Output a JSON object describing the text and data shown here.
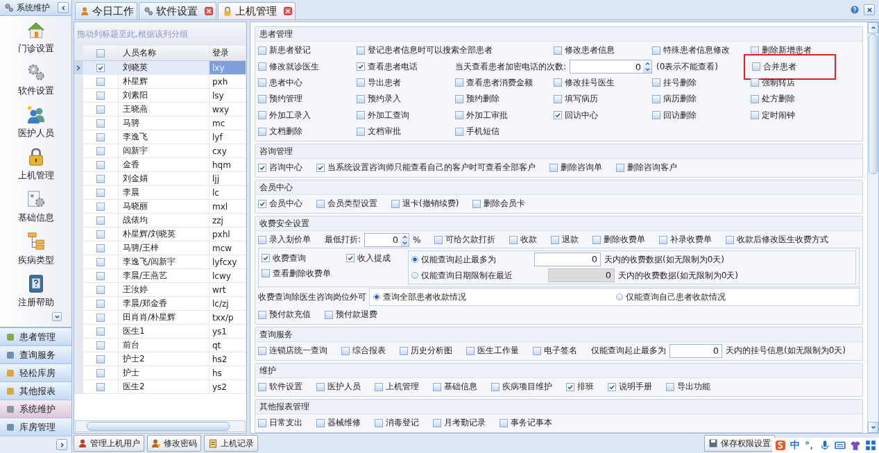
{
  "sidebar": {
    "title": "系统维护",
    "items": [
      {
        "label": "门诊设置"
      },
      {
        "label": "软件设置"
      },
      {
        "label": "医护人员"
      },
      {
        "label": "上机管理"
      },
      {
        "label": "基础信息"
      },
      {
        "label": "疾病类型"
      },
      {
        "label": "注册帮助"
      }
    ],
    "nav": [
      {
        "label": "患者管理",
        "selected": false
      },
      {
        "label": "查询服务",
        "selected": false
      },
      {
        "label": "轻松库房",
        "selected": false
      },
      {
        "label": "其他报表",
        "selected": false
      },
      {
        "label": "系统维护",
        "selected": true
      },
      {
        "label": "库房管理",
        "selected": false
      }
    ]
  },
  "tabs": [
    {
      "label": "今日工作",
      "selected": false,
      "closable": false
    },
    {
      "label": "软件设置",
      "selected": false,
      "closable": true
    },
    {
      "label": "上机管理",
      "selected": true,
      "closable": true
    }
  ],
  "users": {
    "group_hint": "拖动列标题至此,根据该列分组",
    "all_checked": false,
    "columns": [
      "人员名称",
      "登录"
    ],
    "rows": [
      {
        "name": "刘晓英",
        "login": "lxy",
        "checked": true,
        "selected": true
      },
      {
        "name": "朴星辉",
        "login": "pxh",
        "checked": false,
        "selected": false
      },
      {
        "name": "刘素阳",
        "login": "lsy",
        "checked": false,
        "selected": false
      },
      {
        "name": "王晓燕",
        "login": "wxy",
        "checked": false,
        "selected": false
      },
      {
        "name": "马骋",
        "login": "mc",
        "checked": false,
        "selected": false
      },
      {
        "name": "李逸飞",
        "login": "lyf",
        "checked": false,
        "selected": false
      },
      {
        "name": "闾新宇",
        "login": "cxy",
        "checked": false,
        "selected": false
      },
      {
        "name": "金香",
        "login": "hqm",
        "checked": false,
        "selected": false
      },
      {
        "name": "刘金娟",
        "login": "ljj",
        "checked": false,
        "selected": false
      },
      {
        "name": "李晨",
        "login": "lc",
        "checked": false,
        "selected": false
      },
      {
        "name": "马晓丽",
        "login": "mxl",
        "checked": false,
        "selected": false
      },
      {
        "name": "战俵均",
        "login": "zzj",
        "checked": false,
        "selected": false
      },
      {
        "name": "朴星辉/刘晓英",
        "login": "pxhl",
        "checked": false,
        "selected": false
      },
      {
        "name": "马骋/王梓",
        "login": "mcw",
        "checked": false,
        "selected": false
      },
      {
        "name": "李逸飞/闾新宇",
        "login": "lyfcxy",
        "checked": false,
        "selected": false
      },
      {
        "name": "李晨/王燕艺",
        "login": "lcwy",
        "checked": false,
        "selected": false
      },
      {
        "name": "王汝婷",
        "login": "wrt",
        "checked": false,
        "selected": false
      },
      {
        "name": "李晨/郑金香",
        "login": "lc/zj",
        "checked": false,
        "selected": false
      },
      {
        "name": "田肖肖/朴星辉",
        "login": "txx/p",
        "checked": false,
        "selected": false
      },
      {
        "name": "医生1",
        "login": "ys1",
        "checked": false,
        "selected": false
      },
      {
        "name": "前台",
        "login": "qt",
        "checked": false,
        "selected": false
      },
      {
        "name": "护士2",
        "login": "hs2",
        "checked": false,
        "selected": false
      },
      {
        "name": "护士",
        "login": "hs",
        "checked": false,
        "selected": false
      },
      {
        "name": "医生2",
        "login": "ys2",
        "checked": false,
        "selected": false
      }
    ],
    "buttons": [
      "管理上机用户",
      "修改密码",
      "上机记录"
    ]
  },
  "sections": [
    {
      "title": "患者管理",
      "kind": "grid",
      "rows": [
        [
          {
            "kind": "checkbox",
            "label": "新患者登记",
            "checked": false
          },
          {
            "kind": "checkbox",
            "label": "登记患者信息时可以搜索全部患者",
            "checked": false
          },
          {
            "kind": "checkbox",
            "label": "修改患者信息",
            "checked": false
          },
          {
            "kind": "checkbox",
            "label": "特殊患者信息修改",
            "checked": false
          },
          {
            "kind": "checkbox",
            "label": "删除新增患者",
            "checked": false
          }
        ],
        [
          {
            "kind": "checkbox",
            "label": "修改就诊医生",
            "checked": false
          },
          {
            "kind": "checkbox",
            "label": "查看患者电话",
            "checked": true
          },
          {
            "kind": "spin",
            "label": "当天查看患者加密电话的次数:",
            "value": "0"
          },
          {
            "kind": "note",
            "label": "(0表示不能查看)"
          },
          {
            "kind": "checkbox",
            "label": "合并患者",
            "checked": false,
            "highlighted": true
          }
        ],
        [
          {
            "kind": "checkbox",
            "label": "患者中心",
            "checked": false
          },
          {
            "kind": "checkbox",
            "label": "导出患者",
            "checked": false
          },
          {
            "kind": "checkbox",
            "label": "查看患者消费金额",
            "checked": false
          },
          {
            "kind": "checkbox",
            "label": "修改挂号医生",
            "checked": false
          },
          {
            "kind": "checkbox",
            "label": "挂号删除",
            "checked": false
          },
          {
            "kind": "checkbox",
            "label": "强制转店",
            "checked": false
          }
        ],
        [
          {
            "kind": "checkbox",
            "label": "预约管理",
            "checked": false
          },
          {
            "kind": "checkbox",
            "label": "预约录入",
            "checked": false
          },
          {
            "kind": "checkbox",
            "label": "预约删除",
            "checked": false
          },
          {
            "kind": "checkbox",
            "label": "填写病历",
            "checked": false
          },
          {
            "kind": "checkbox",
            "label": "病历删除",
            "checked": false
          },
          {
            "kind": "checkbox",
            "label": "处方删除",
            "checked": false
          }
        ],
        [
          {
            "kind": "checkbox",
            "label": "外加工录入",
            "checked": false
          },
          {
            "kind": "checkbox",
            "label": "外加工查询",
            "checked": false
          },
          {
            "kind": "checkbox",
            "label": "外加工审批",
            "checked": false
          },
          {
            "kind": "checkbox",
            "label": "回访中心",
            "checked": true
          },
          {
            "kind": "checkbox",
            "label": "回访删除",
            "checked": false
          },
          {
            "kind": "checkbox",
            "label": "定时闹钟",
            "checked": false
          }
        ],
        [
          {
            "kind": "checkbox",
            "label": "文档删除",
            "checked": false
          },
          {
            "kind": "checkbox",
            "label": "文档审批",
            "checked": false
          },
          {
            "kind": "checkbox",
            "label": "手机短信",
            "checked": false
          }
        ]
      ]
    },
    {
      "title": "咨询管理",
      "kind": "flow",
      "rows": [
        [
          {
            "kind": "checkbox",
            "label": "咨询中心",
            "checked": true
          },
          {
            "kind": "checkbox",
            "label": "当系统设置咨询师只能查看自己的客户时可查看全部客户",
            "checked": true
          },
          {
            "kind": "checkbox",
            "label": "删除咨询单",
            "checked": false
          },
          {
            "kind": "checkbox",
            "label": "删除咨询客户",
            "checked": false
          }
        ]
      ]
    },
    {
      "title": "会员中心",
      "kind": "flow",
      "rows": [
        [
          {
            "kind": "checkbox",
            "label": "会员中心",
            "checked": true
          },
          {
            "kind": "checkbox",
            "label": "会员类型设置",
            "checked": false
          },
          {
            "kind": "checkbox",
            "label": "退卡(撤销续费)",
            "checked": false
          },
          {
            "kind": "checkbox",
            "label": "删除会员卡",
            "checked": false
          }
        ]
      ]
    },
    {
      "title": "收费安全设置",
      "kind": "flow",
      "rows": [
        [
          {
            "kind": "checkbox",
            "label": "录入划价单",
            "checked": false
          },
          {
            "kind": "spin",
            "label": "最低打折:",
            "value": "0",
            "unit": "%"
          },
          {
            "kind": "checkbox",
            "label": "可给欠款打折",
            "checked": false
          },
          {
            "kind": "checkbox",
            "label": "收款",
            "checked": false
          },
          {
            "kind": "checkbox",
            "label": "退款",
            "checked": false
          },
          {
            "kind": "checkbox",
            "label": "删除收费单",
            "checked": false
          },
          {
            "kind": "checkbox",
            "label": "补录收费单",
            "checked": false
          },
          {
            "kind": "checkbox",
            "label": "收款后修改医生收费方式",
            "checked": false
          }
        ],
        [
          {
            "kind": "query_box",
            "checks": [
              {
                "label": "收费查询",
                "checked": true
              },
              {
                "label": "收入提成",
                "checked": true
              },
              {
                "label": "查看删除收费单",
                "checked": false
              }
            ],
            "ranges": [
              {
                "label": "仅能查询起止最多为",
                "selected": true,
                "value": "0",
                "suffix": "天内的收费数据(如无限制为0天)",
                "disabled": false
              },
              {
                "label": "仅能查询日期限制在最近",
                "selected": false,
                "value": "0",
                "suffix": "天内的收费数据(如无限制为0天)",
                "disabled": true
              }
            ]
          }
        ],
        [
          {
            "kind": "scope",
            "label": "收费查询除医生咨询岗位外可",
            "options": [
              {
                "label": "查询全部患者收款情况",
                "selected": true
              },
              {
                "label": "仅能查询自己患者收款情况",
                "selected": false
              }
            ]
          }
        ],
        [
          {
            "kind": "checkbox",
            "label": "预付款充值",
            "checked": false
          },
          {
            "kind": "checkbox",
            "label": "预付款退费",
            "checked": false
          }
        ]
      ]
    },
    {
      "title": "查询服务",
      "kind": "flow",
      "rows": [
        [
          {
            "kind": "checkbox",
            "label": "连锁店统一查询",
            "checked": false
          },
          {
            "kind": "checkbox",
            "label": "综合报表",
            "checked": false
          },
          {
            "kind": "checkbox",
            "label": "历史分析图",
            "checked": false
          },
          {
            "kind": "checkbox",
            "label": "医生工作量",
            "checked": false
          },
          {
            "kind": "checkbox",
            "label": "电子签名",
            "checked": false
          },
          {
            "kind": "number",
            "label": "仅能查询起止最多为",
            "value": "0",
            "suffix": "天内的挂号信息(如无限制为0天)"
          }
        ]
      ]
    },
    {
      "title": "维护",
      "kind": "flow",
      "rows": [
        [
          {
            "kind": "checkbox",
            "label": "软件设置",
            "checked": false
          },
          {
            "kind": "checkbox",
            "label": "医护人员",
            "checked": false
          },
          {
            "kind": "checkbox",
            "label": "上机管理",
            "checked": false
          },
          {
            "kind": "checkbox",
            "label": "基础信息",
            "checked": false
          },
          {
            "kind": "checkbox",
            "label": "疾病项目维护",
            "checked": false
          },
          {
            "kind": "checkbox",
            "label": "排班",
            "checked": true
          },
          {
            "kind": "checkbox",
            "label": "说明手册",
            "checked": true
          },
          {
            "kind": "checkbox",
            "label": "导出功能",
            "checked": false
          }
        ]
      ]
    },
    {
      "title": "其他报表管理",
      "kind": "flow",
      "rows": [
        [
          {
            "kind": "checkbox",
            "label": "日常支出",
            "checked": false
          },
          {
            "kind": "checkbox",
            "label": "器械维修",
            "checked": false
          },
          {
            "kind": "checkbox",
            "label": "消毒登记",
            "checked": false
          },
          {
            "kind": "checkbox",
            "label": "月考勤记录",
            "checked": false
          },
          {
            "kind": "checkbox",
            "label": "事务记事本",
            "checked": false
          }
        ]
      ]
    }
  ],
  "save_button": "保存权限设置",
  "ime": {
    "mode": "中"
  }
}
